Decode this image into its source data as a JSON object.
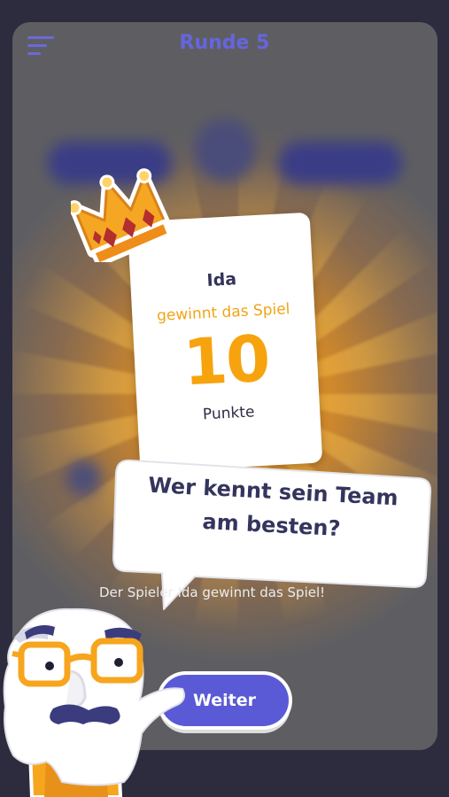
{
  "header": {
    "title": "Runde 5",
    "menu_icon": "hamburger-menu-icon"
  },
  "result_card": {
    "player": "Ida",
    "wins_text": "gewinnt das Spiel",
    "points": "10",
    "points_unit": "Punkte",
    "crown_icon": "crown-icon"
  },
  "speech_bubble": {
    "text": "Wer kennt sein Team am besten?"
  },
  "status_text": "Der Spieler Ida gewinnt das Spiel!",
  "next_button": {
    "label": "Weiter"
  },
  "colors": {
    "background": "#2d2c3e",
    "panel": "#5e5e62",
    "accent": "#5a5ad6",
    "gold": "#f7a30d",
    "text_dark": "#32325a"
  }
}
